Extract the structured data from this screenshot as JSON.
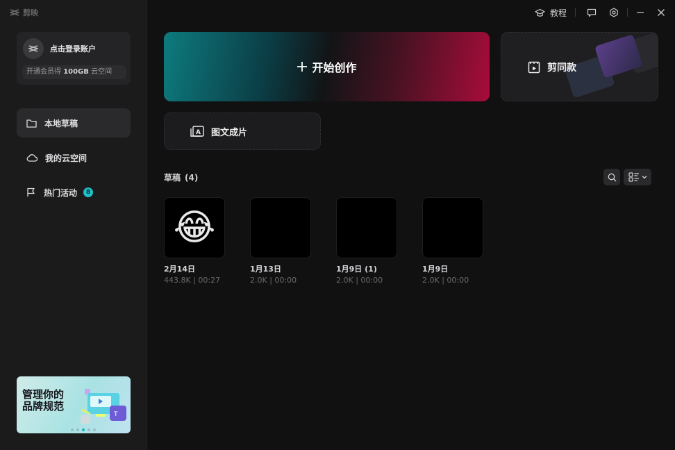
{
  "app": {
    "name": "剪映"
  },
  "titlebar": {
    "tutorial": "教程"
  },
  "account": {
    "login_text": "点击登录账户",
    "vip_prefix": "开通会员得 ",
    "vip_amount": "100GB",
    "vip_suffix": " 云空间"
  },
  "sidebar": {
    "items": [
      {
        "label": "本地草稿",
        "icon": "folder-icon",
        "active": true
      },
      {
        "label": "我的云空间",
        "icon": "cloud-icon"
      },
      {
        "label": "热门活动",
        "icon": "flag-icon",
        "badge": "8"
      }
    ]
  },
  "promo": {
    "line1": "管理你的",
    "line2": "品牌规范"
  },
  "main": {
    "create_label": "开始创作",
    "template_label": "剪同款",
    "image_text_label": "图文成片",
    "drafts_title": "草稿",
    "drafts_count": "(4)",
    "drafts": [
      {
        "name": "2月14日",
        "meta": "443.8K | 00:27",
        "emoji": "😂"
      },
      {
        "name": "1月13日",
        "meta": "2.0K | 00:00"
      },
      {
        "name": "1月9日 (1)",
        "meta": "2.0K | 00:00"
      },
      {
        "name": "1月9日",
        "meta": "2.0K | 00:00"
      }
    ]
  },
  "colors": {
    "accent": "#1ec0c9",
    "create_left": "#0d7b7e",
    "create_right": "#a80c3b"
  }
}
